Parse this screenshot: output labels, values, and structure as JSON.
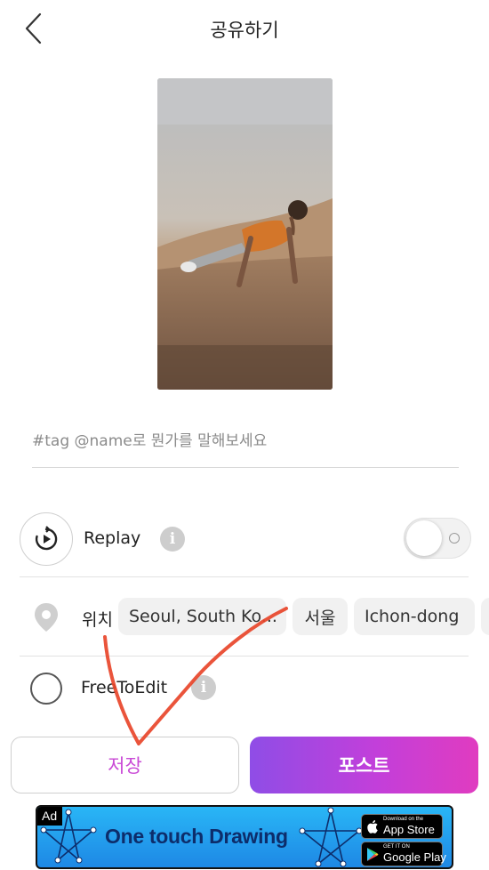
{
  "header": {
    "title": "공유하기",
    "back_icon": "chevron-left-icon"
  },
  "caption": {
    "placeholder": "#tag @name로 뭔가를 말해보세요",
    "value": ""
  },
  "replay": {
    "label": "Replay",
    "icon": "replay-icon",
    "enabled": false
  },
  "location": {
    "label": "위치",
    "icon": "location-pin-icon",
    "chips": [
      "Seoul, South Ko...",
      "서울",
      "Ichon-dong"
    ]
  },
  "free_to_edit": {
    "label": "FreeToEdit",
    "checked": false
  },
  "actions": {
    "save_label": "저장",
    "post_label": "포스트"
  },
  "ad": {
    "tag": "Ad",
    "headline": "One touch Drawing",
    "app_store_small": "Download on the",
    "app_store_big": "App Store",
    "google_play_small": "GET IT ON",
    "google_play_big": "Google Play"
  },
  "colors": {
    "accent_start": "#8f4de6",
    "accent_end": "#e03cc0",
    "save_text": "#c94ad6",
    "annotation": "#e8452a"
  }
}
